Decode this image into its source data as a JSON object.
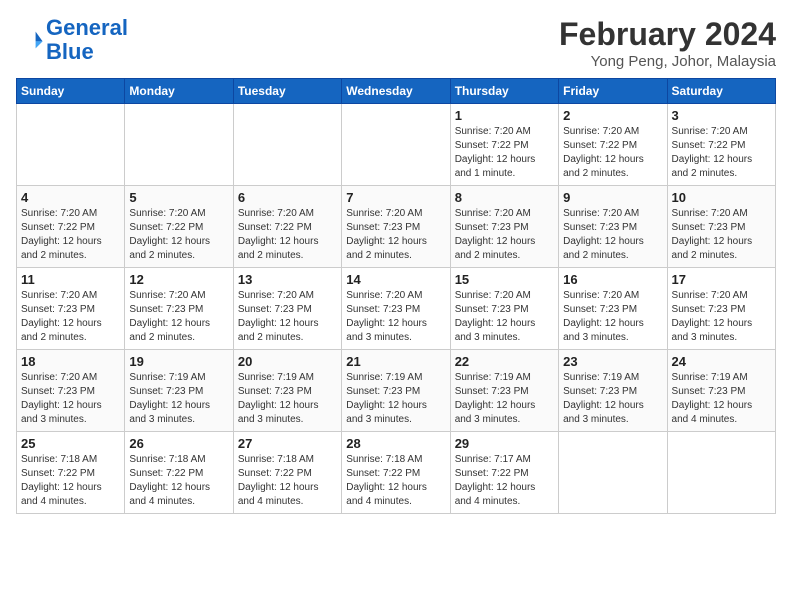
{
  "header": {
    "logo_line1": "General",
    "logo_line2": "Blue",
    "month_year": "February 2024",
    "location": "Yong Peng, Johor, Malaysia"
  },
  "days_of_week": [
    "Sunday",
    "Monday",
    "Tuesday",
    "Wednesday",
    "Thursday",
    "Friday",
    "Saturday"
  ],
  "weeks": [
    [
      {
        "day": "",
        "info": ""
      },
      {
        "day": "",
        "info": ""
      },
      {
        "day": "",
        "info": ""
      },
      {
        "day": "",
        "info": ""
      },
      {
        "day": "1",
        "info": "Sunrise: 7:20 AM\nSunset: 7:22 PM\nDaylight: 12 hours\nand 1 minute."
      },
      {
        "day": "2",
        "info": "Sunrise: 7:20 AM\nSunset: 7:22 PM\nDaylight: 12 hours\nand 2 minutes."
      },
      {
        "day": "3",
        "info": "Sunrise: 7:20 AM\nSunset: 7:22 PM\nDaylight: 12 hours\nand 2 minutes."
      }
    ],
    [
      {
        "day": "4",
        "info": "Sunrise: 7:20 AM\nSunset: 7:22 PM\nDaylight: 12 hours\nand 2 minutes."
      },
      {
        "day": "5",
        "info": "Sunrise: 7:20 AM\nSunset: 7:22 PM\nDaylight: 12 hours\nand 2 minutes."
      },
      {
        "day": "6",
        "info": "Sunrise: 7:20 AM\nSunset: 7:22 PM\nDaylight: 12 hours\nand 2 minutes."
      },
      {
        "day": "7",
        "info": "Sunrise: 7:20 AM\nSunset: 7:23 PM\nDaylight: 12 hours\nand 2 minutes."
      },
      {
        "day": "8",
        "info": "Sunrise: 7:20 AM\nSunset: 7:23 PM\nDaylight: 12 hours\nand 2 minutes."
      },
      {
        "day": "9",
        "info": "Sunrise: 7:20 AM\nSunset: 7:23 PM\nDaylight: 12 hours\nand 2 minutes."
      },
      {
        "day": "10",
        "info": "Sunrise: 7:20 AM\nSunset: 7:23 PM\nDaylight: 12 hours\nand 2 minutes."
      }
    ],
    [
      {
        "day": "11",
        "info": "Sunrise: 7:20 AM\nSunset: 7:23 PM\nDaylight: 12 hours\nand 2 minutes."
      },
      {
        "day": "12",
        "info": "Sunrise: 7:20 AM\nSunset: 7:23 PM\nDaylight: 12 hours\nand 2 minutes."
      },
      {
        "day": "13",
        "info": "Sunrise: 7:20 AM\nSunset: 7:23 PM\nDaylight: 12 hours\nand 2 minutes."
      },
      {
        "day": "14",
        "info": "Sunrise: 7:20 AM\nSunset: 7:23 PM\nDaylight: 12 hours\nand 3 minutes."
      },
      {
        "day": "15",
        "info": "Sunrise: 7:20 AM\nSunset: 7:23 PM\nDaylight: 12 hours\nand 3 minutes."
      },
      {
        "day": "16",
        "info": "Sunrise: 7:20 AM\nSunset: 7:23 PM\nDaylight: 12 hours\nand 3 minutes."
      },
      {
        "day": "17",
        "info": "Sunrise: 7:20 AM\nSunset: 7:23 PM\nDaylight: 12 hours\nand 3 minutes."
      }
    ],
    [
      {
        "day": "18",
        "info": "Sunrise: 7:20 AM\nSunset: 7:23 PM\nDaylight: 12 hours\nand 3 minutes."
      },
      {
        "day": "19",
        "info": "Sunrise: 7:19 AM\nSunset: 7:23 PM\nDaylight: 12 hours\nand 3 minutes."
      },
      {
        "day": "20",
        "info": "Sunrise: 7:19 AM\nSunset: 7:23 PM\nDaylight: 12 hours\nand 3 minutes."
      },
      {
        "day": "21",
        "info": "Sunrise: 7:19 AM\nSunset: 7:23 PM\nDaylight: 12 hours\nand 3 minutes."
      },
      {
        "day": "22",
        "info": "Sunrise: 7:19 AM\nSunset: 7:23 PM\nDaylight: 12 hours\nand 3 minutes."
      },
      {
        "day": "23",
        "info": "Sunrise: 7:19 AM\nSunset: 7:23 PM\nDaylight: 12 hours\nand 3 minutes."
      },
      {
        "day": "24",
        "info": "Sunrise: 7:19 AM\nSunset: 7:23 PM\nDaylight: 12 hours\nand 4 minutes."
      }
    ],
    [
      {
        "day": "25",
        "info": "Sunrise: 7:18 AM\nSunset: 7:22 PM\nDaylight: 12 hours\nand 4 minutes."
      },
      {
        "day": "26",
        "info": "Sunrise: 7:18 AM\nSunset: 7:22 PM\nDaylight: 12 hours\nand 4 minutes."
      },
      {
        "day": "27",
        "info": "Sunrise: 7:18 AM\nSunset: 7:22 PM\nDaylight: 12 hours\nand 4 minutes."
      },
      {
        "day": "28",
        "info": "Sunrise: 7:18 AM\nSunset: 7:22 PM\nDaylight: 12 hours\nand 4 minutes."
      },
      {
        "day": "29",
        "info": "Sunrise: 7:17 AM\nSunset: 7:22 PM\nDaylight: 12 hours\nand 4 minutes."
      },
      {
        "day": "",
        "info": ""
      },
      {
        "day": "",
        "info": ""
      }
    ]
  ]
}
